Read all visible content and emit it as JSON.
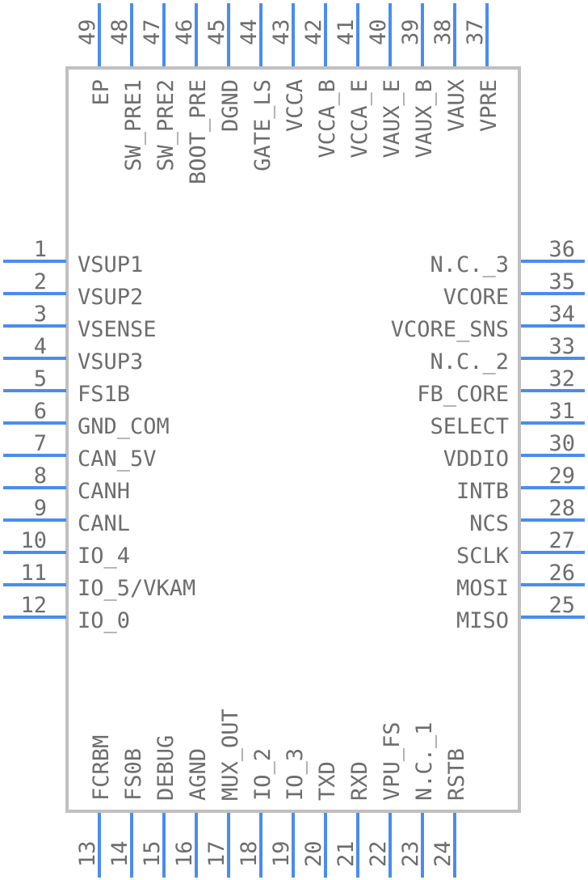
{
  "component": {
    "type": "IC schematic symbol",
    "colors": {
      "pin": "#4a8cf0",
      "body_outline": "#c0c0c0",
      "text": "#6d6d6d",
      "background": "#ffffff"
    }
  },
  "pins": {
    "left": [
      {
        "number": "1",
        "name": "VSUP1"
      },
      {
        "number": "2",
        "name": "VSUP2"
      },
      {
        "number": "3",
        "name": "VSENSE"
      },
      {
        "number": "4",
        "name": "VSUP3"
      },
      {
        "number": "5",
        "name": "FS1B"
      },
      {
        "number": "6",
        "name": "GND_COM"
      },
      {
        "number": "7",
        "name": "CAN_5V"
      },
      {
        "number": "8",
        "name": "CANH"
      },
      {
        "number": "9",
        "name": "CANL"
      },
      {
        "number": "10",
        "name": "IO_4"
      },
      {
        "number": "11",
        "name": "IO_5/VKAM"
      },
      {
        "number": "12",
        "name": "IO_0"
      }
    ],
    "bottom": [
      {
        "number": "13",
        "name": "FCRBM"
      },
      {
        "number": "14",
        "name": "FS0B"
      },
      {
        "number": "15",
        "name": "DEBUG"
      },
      {
        "number": "16",
        "name": "AGND"
      },
      {
        "number": "17",
        "name": "MUX_OUT"
      },
      {
        "number": "18",
        "name": "IO_2"
      },
      {
        "number": "19",
        "name": "IO_3"
      },
      {
        "number": "20",
        "name": "TXD"
      },
      {
        "number": "21",
        "name": "RXD"
      },
      {
        "number": "22",
        "name": "VPU_FS"
      },
      {
        "number": "23",
        "name": "N.C._1"
      },
      {
        "number": "24",
        "name": "RSTB"
      }
    ],
    "right": [
      {
        "number": "25",
        "name": "MISO"
      },
      {
        "number": "26",
        "name": "MOSI"
      },
      {
        "number": "27",
        "name": "SCLK"
      },
      {
        "number": "28",
        "name": "NCS"
      },
      {
        "number": "29",
        "name": "INTB"
      },
      {
        "number": "30",
        "name": "VDDIO"
      },
      {
        "number": "31",
        "name": "SELECT"
      },
      {
        "number": "32",
        "name": "FB_CORE"
      },
      {
        "number": "33",
        "name": "N.C._2"
      },
      {
        "number": "34",
        "name": "VCORE_SNS"
      },
      {
        "number": "35",
        "name": "VCORE"
      },
      {
        "number": "36",
        "name": "N.C._3"
      }
    ],
    "top": [
      {
        "number": "37",
        "name": "VPRE"
      },
      {
        "number": "38",
        "name": "VAUX"
      },
      {
        "number": "39",
        "name": "VAUX_B"
      },
      {
        "number": "40",
        "name": "VAUX_E"
      },
      {
        "number": "41",
        "name": "VCCA_E"
      },
      {
        "number": "42",
        "name": "VCCA_B"
      },
      {
        "number": "43",
        "name": "VCCA"
      },
      {
        "number": "44",
        "name": "GATE_LS"
      },
      {
        "number": "45",
        "name": "DGND"
      },
      {
        "number": "46",
        "name": "BOOT_PRE"
      },
      {
        "number": "47",
        "name": "SW_PRE2"
      },
      {
        "number": "48",
        "name": "SW_PRE1"
      },
      {
        "number": "49",
        "name": "EP"
      }
    ]
  }
}
